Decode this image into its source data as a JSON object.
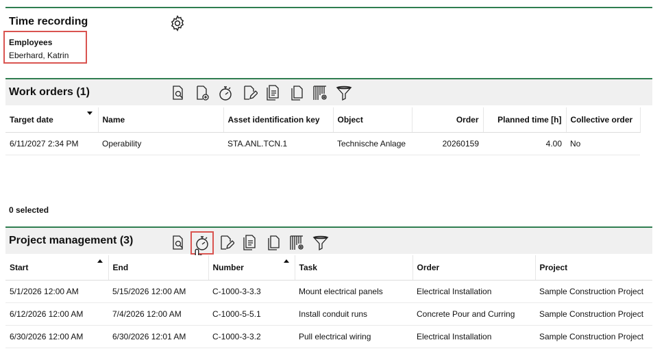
{
  "time_recording": {
    "title": "Time recording",
    "employees_label": "Employees",
    "employee_value": "Eberhard, Katrin"
  },
  "work_orders": {
    "title": "Work orders (1)",
    "columns": [
      "Target date",
      "Name",
      "Asset identification key",
      "Object",
      "Order",
      "Planned time [h]",
      "Collective order"
    ],
    "rows": [
      [
        "6/11/2027 2:34 PM",
        "Operability",
        "STA.ANL.TCN.1",
        "Technische Anlage",
        "20260159",
        "4.00",
        "No"
      ]
    ],
    "selected": "0 selected"
  },
  "project_management": {
    "title": "Project management (3)",
    "columns": [
      "Start",
      "End",
      "Number",
      "Task",
      "Order",
      "Project"
    ],
    "rows": [
      [
        "5/1/2026 12:00 AM",
        "5/15/2026 12:00 AM",
        "C-1000-3-3.3",
        "Mount electrical panels",
        "Electrical Installation",
        "Sample Construction Project"
      ],
      [
        "6/12/2026 12:00 AM",
        "7/4/2026 12:00 AM",
        "C-1000-5-5.1",
        "Install conduit runs",
        "Concrete Pour and Curring",
        "Sample Construction Project"
      ],
      [
        "6/30/2026 12:00 AM",
        "6/30/2026 12:01 AM",
        "C-1000-3-3.2",
        "Pull electrical wiring",
        "Electrical Installation",
        "Sample Construction Project"
      ]
    ]
  },
  "icons": {
    "work_orders_toolbar": [
      "document-search-icon",
      "document-add-icon",
      "stopwatch-icon",
      "document-edit-icon",
      "document-list-icon",
      "copy-icon",
      "columns-settings-icon",
      "filter-icon"
    ],
    "project_toolbar": [
      "document-search-icon",
      "stopwatch-icon",
      "document-edit-icon",
      "document-list-icon",
      "copy-icon",
      "columns-settings-icon",
      "filter-icon"
    ]
  },
  "colors": {
    "section_rule": "#2e7d4f",
    "highlight": "#d9534f"
  }
}
